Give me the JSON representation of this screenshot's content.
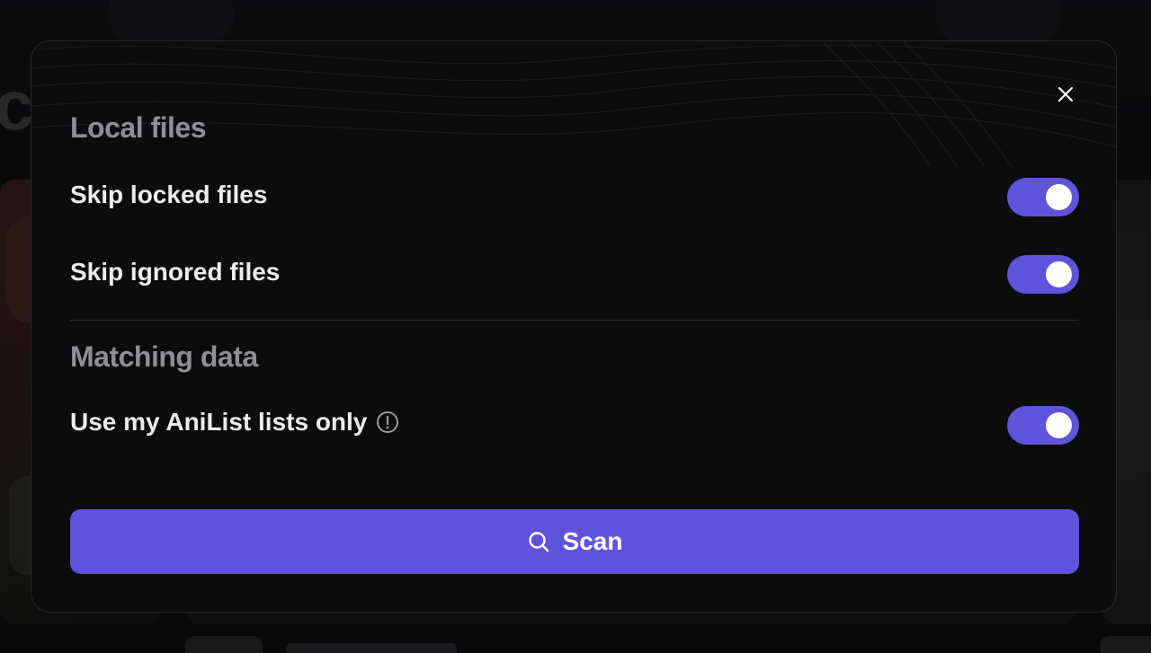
{
  "modal": {
    "sections": [
      {
        "title": "Local files",
        "options": [
          {
            "label": "Skip locked files",
            "enabled": true
          },
          {
            "label": "Skip ignored files",
            "enabled": true
          }
        ]
      },
      {
        "title": "Matching data",
        "options": [
          {
            "label": "Use my AniList lists only",
            "enabled": true,
            "has_info_icon": true
          }
        ]
      }
    ],
    "close_icon": "close-icon",
    "scan_button": {
      "label": "Scan",
      "icon": "search-icon"
    }
  },
  "colors": {
    "accent": "#5f54d9",
    "modal_background": "#0c0c0d",
    "section_title": "#8e8e93",
    "option_label": "#ececee"
  }
}
